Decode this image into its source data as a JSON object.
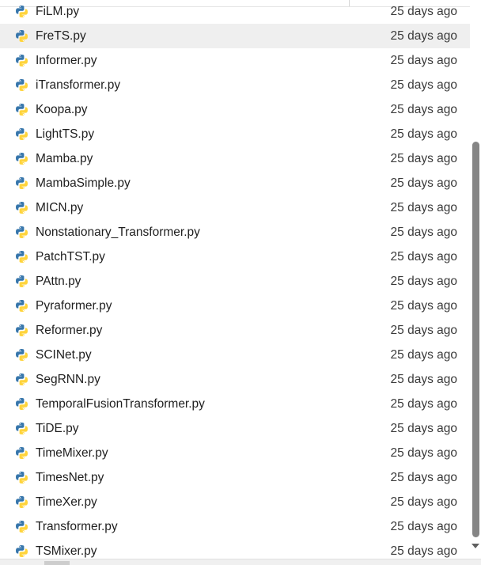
{
  "colors": {
    "hover_row": "#efefef",
    "python_blue": "#3776ab",
    "python_yellow": "#ffd43b",
    "text": "#1f1f1f",
    "date_text": "#3a3a3a",
    "scroll_thumb": "#858585"
  },
  "file_icon": "python-file-icon",
  "files": [
    {
      "name": "FiLM.py",
      "modified": "25 days ago"
    },
    {
      "name": "FreTS.py",
      "modified": "25 days ago"
    },
    {
      "name": "Informer.py",
      "modified": "25 days ago"
    },
    {
      "name": "iTransformer.py",
      "modified": "25 days ago"
    },
    {
      "name": "Koopa.py",
      "modified": "25 days ago"
    },
    {
      "name": "LightTS.py",
      "modified": "25 days ago"
    },
    {
      "name": "Mamba.py",
      "modified": "25 days ago"
    },
    {
      "name": "MambaSimple.py",
      "modified": "25 days ago"
    },
    {
      "name": "MICN.py",
      "modified": "25 days ago"
    },
    {
      "name": "Nonstationary_Transformer.py",
      "modified": "25 days ago"
    },
    {
      "name": "PatchTST.py",
      "modified": "25 days ago"
    },
    {
      "name": "PAttn.py",
      "modified": "25 days ago"
    },
    {
      "name": "Pyraformer.py",
      "modified": "25 days ago"
    },
    {
      "name": "Reformer.py",
      "modified": "25 days ago"
    },
    {
      "name": "SCINet.py",
      "modified": "25 days ago"
    },
    {
      "name": "SegRNN.py",
      "modified": "25 days ago"
    },
    {
      "name": "TemporalFusionTransformer.py",
      "modified": "25 days ago"
    },
    {
      "name": "TiDE.py",
      "modified": "25 days ago"
    },
    {
      "name": "TimeMixer.py",
      "modified": "25 days ago"
    },
    {
      "name": "TimesNet.py",
      "modified": "25 days ago"
    },
    {
      "name": "TimeXer.py",
      "modified": "25 days ago"
    },
    {
      "name": "Transformer.py",
      "modified": "25 days ago"
    },
    {
      "name": "TSMixer.py",
      "modified": "25 days ago"
    }
  ],
  "hovered_file": "FreTS.py"
}
